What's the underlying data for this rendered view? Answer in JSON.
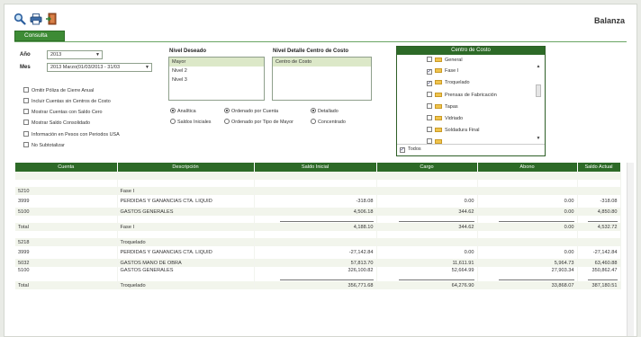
{
  "app_title": "Balanza",
  "toolbar": {
    "icons": [
      "search-icon",
      "print-icon",
      "exit-door-icon"
    ],
    "consulta_label": "Consulta"
  },
  "filters": {
    "anio_label": "Año",
    "anio_value": "2013",
    "mes_label": "Mes",
    "mes_value": "2013 Marzo(01/03/2013 - 31/03"
  },
  "options": [
    {
      "label": "Omitir Póliza de Cierre Anual",
      "checked": false
    },
    {
      "label": "Incluir Cuentas sin Centros de Costo",
      "checked": false
    },
    {
      "label": "Mostrar Cuentas con Saldo Cero",
      "checked": false
    },
    {
      "label": "Mostrar Saldo Consolidado",
      "checked": false
    },
    {
      "label": "Información en Pesos con Periodos USA",
      "checked": false
    },
    {
      "label": "No Subtotalizar",
      "checked": false
    }
  ],
  "nivel_deseado": {
    "label": "Nivel Deseado",
    "items": [
      "Mayor",
      "Nivel 2",
      "Nivel 3"
    ],
    "selected": "Mayor"
  },
  "nivel_detalle": {
    "label": "Nivel Detalle Centro de Costo",
    "items": [
      "Centro de Costo"
    ]
  },
  "radio_options": [
    {
      "label": "Analítica",
      "checked": true
    },
    {
      "label": "Ordenado por Cuenta",
      "checked": true
    },
    {
      "label": "Detallado",
      "checked": true
    },
    {
      "label": "Saldos Iniciales",
      "checked": false
    },
    {
      "label": "Ordenado por Tipo de Mayor",
      "checked": false
    },
    {
      "label": "Concentrado",
      "checked": false
    }
  ],
  "centro_de_costo": {
    "title": "Centro de Costo",
    "items": [
      {
        "label": "General",
        "checked": false
      },
      {
        "label": "Fase I",
        "checked": true
      },
      {
        "label": "Troquelado",
        "checked": true
      },
      {
        "label": "Prensas de Fabricación",
        "checked": false
      },
      {
        "label": "Tapas",
        "checked": false
      },
      {
        "label": "Vidriado",
        "checked": false
      },
      {
        "label": "Soldadura Final",
        "checked": false
      }
    ],
    "todos_label": "Todos",
    "todos_checked": true
  },
  "table": {
    "headers": [
      "Cuenta",
      "Descripción",
      "Saldo Inicial",
      "Cargo",
      "Abono",
      "Saldo Actual"
    ],
    "rows": [
      {
        "cuenta": "5210",
        "descripcion": "Fase I",
        "saldo_inicial": "",
        "cargo": "",
        "abono": "",
        "saldo_actual": ""
      },
      {
        "cuenta": "3999",
        "descripcion": "PERDIDAS Y GANANCIAS CTA. LIQUID",
        "saldo_inicial": "-318.08",
        "cargo": "0.00",
        "abono": "0.00",
        "saldo_actual": "-318.08"
      },
      {
        "cuenta": "5100",
        "descripcion": "GASTOS GENERALES",
        "saldo_inicial": "4,506.18",
        "cargo": "344.62",
        "abono": "0.00",
        "saldo_actual": "4,850.80"
      },
      {
        "cuenta": "Total",
        "descripcion": "Fase I",
        "saldo_inicial": "4,188.10",
        "cargo": "344.62",
        "abono": "0.00",
        "saldo_actual": "4,532.72"
      },
      {
        "cuenta": "5218",
        "descripcion": "Troquelado",
        "saldo_inicial": "",
        "cargo": "",
        "abono": "",
        "saldo_actual": ""
      },
      {
        "cuenta": "3999",
        "descripcion": "PERDIDAS Y GANANCIAS CTA. LIQUID",
        "saldo_inicial": "-27,142.84",
        "cargo": "0.00",
        "abono": "0.00",
        "saldo_actual": "-27,142.84"
      },
      {
        "cuenta": "5032",
        "descripcion": "GASTOS MANO DE OBRA",
        "saldo_inicial": "57,813.70",
        "cargo": "11,611.91",
        "abono": "5,964.73",
        "saldo_actual": "63,460.88"
      },
      {
        "cuenta": "5100",
        "descripcion": "GASTOS GENERALES",
        "saldo_inicial": "326,100.82",
        "cargo": "52,664.99",
        "abono": "27,903.34",
        "saldo_actual": "350,862.47"
      },
      {
        "cuenta": "Total",
        "descripcion": "Troquelado",
        "saldo_inicial": "356,771.68",
        "cargo": "64,276.90",
        "abono": "33,868.07",
        "saldo_actual": "387,180.51"
      }
    ]
  }
}
